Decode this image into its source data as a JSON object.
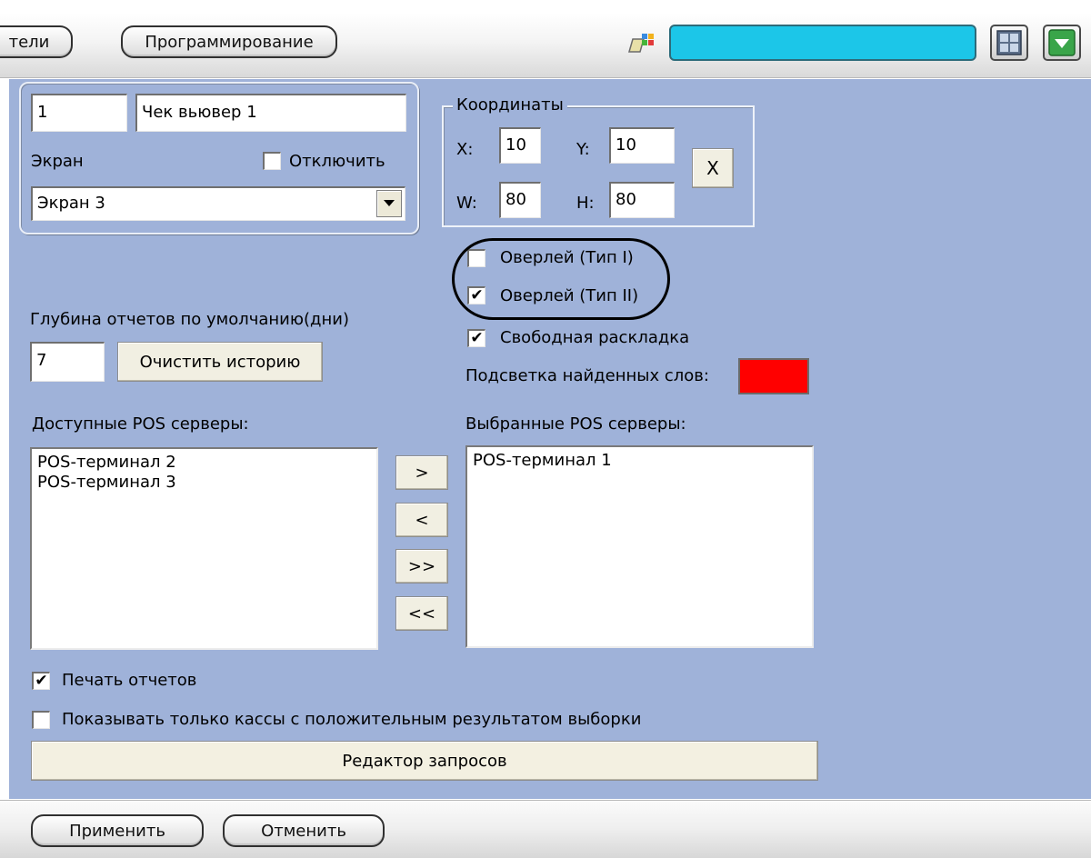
{
  "toolbar": {
    "tab_partial_label": "тели",
    "tab_programming_label": "Программирование",
    "title_value": ""
  },
  "viewer": {
    "id_value": "1",
    "name_value": "Чек вьювер 1",
    "screen_label": "Экран",
    "disable_label": "Отключить",
    "disable_checked": false,
    "screen_select_value": "Экран 3"
  },
  "coordinates": {
    "group_label": "Координаты",
    "x_label": "X:",
    "x_value": "10",
    "y_label": "Y:",
    "y_value": "10",
    "w_label": "W:",
    "w_value": "80",
    "h_label": "H:",
    "h_value": "80",
    "reset_label": "X"
  },
  "options": {
    "overlay1_label": "Оверлей (Тип I)",
    "overlay1_checked": false,
    "overlay2_label": "Оверлей (Тип II)",
    "overlay2_checked": true,
    "free_layout_label": "Свободная раскладка",
    "free_layout_checked": true,
    "highlight_label": "Подсветка найденных слов:",
    "highlight_color": "#ff0000"
  },
  "history": {
    "depth_label": "Глубина отчетов по умолчанию(дни)",
    "depth_value": "7",
    "clear_label": "Очистить историю"
  },
  "servers": {
    "available_label": "Доступные POS серверы:",
    "available_items": [
      "POS-терминал 2",
      "POS-терминал 3"
    ],
    "selected_label": "Выбранные POS серверы:",
    "selected_items": [
      "POS-терминал 1"
    ],
    "move_right": ">",
    "move_left": "<",
    "move_all_right": ">>",
    "move_all_left": "<<"
  },
  "bottom": {
    "print_label": "Печать отчетов",
    "print_checked": true,
    "positive_only_label": "Показывать только кассы с положительным результатом выборки",
    "positive_only_checked": false,
    "query_editor_label": "Редактор запросов"
  },
  "footer": {
    "apply_label": "Применить",
    "cancel_label": "Отменить"
  },
  "colors": {
    "panel_bg": "#9fb2d9",
    "title_field": "#1cc6e8",
    "highlight_ring": "#000000"
  }
}
